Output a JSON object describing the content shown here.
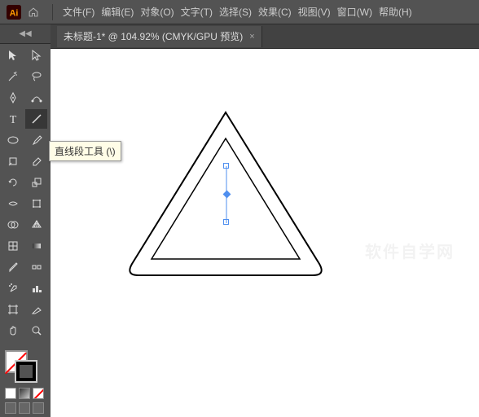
{
  "app": {
    "name": "Adobe Illustrator"
  },
  "menu": {
    "file": "文件(F)",
    "edit": "编辑(E)",
    "object": "对象(O)",
    "type": "文字(T)",
    "select": "选择(S)",
    "effect": "效果(C)",
    "view": "视图(V)",
    "window": "窗口(W)",
    "help": "帮助(H)"
  },
  "tab": {
    "title": "未标题-1* @ 104.92% (CMYK/GPU 预览)",
    "close": "×"
  },
  "tooltip": {
    "text": "直线段工具 (\\)"
  },
  "watermark": "软件自学网",
  "doc": {
    "zoom_percent": 104.92,
    "color_mode": "CMYK",
    "preview": "GPU 预览",
    "filename": "未标题-1",
    "modified": true
  },
  "tools": {
    "selection": "选择工具",
    "direct_selection": "直接选择工具",
    "magic_wand": "魔棒工具",
    "lasso": "套索工具",
    "pen": "钢笔工具",
    "curvature": "曲率工具",
    "type": "文字工具",
    "line_segment": "直线段工具",
    "ellipse": "椭圆工具",
    "paintbrush": "画笔工具",
    "shaper": "Shaper 工具",
    "eraser": "橡皮擦工具",
    "rotate": "旋转工具",
    "scale": "比例缩放工具",
    "width": "宽度工具",
    "free_transform": "自由变换工具",
    "shape_builder": "形状生成器工具",
    "perspective": "透视网格工具",
    "mesh": "网格工具",
    "gradient": "渐变工具",
    "eyedropper": "吸管工具",
    "blend": "混合工具",
    "symbol_sprayer": "符号喷枪工具",
    "column_graph": "柱形图工具",
    "artboard": "画板工具",
    "slice": "切片工具",
    "hand": "抓手工具",
    "zoom": "缩放工具"
  }
}
